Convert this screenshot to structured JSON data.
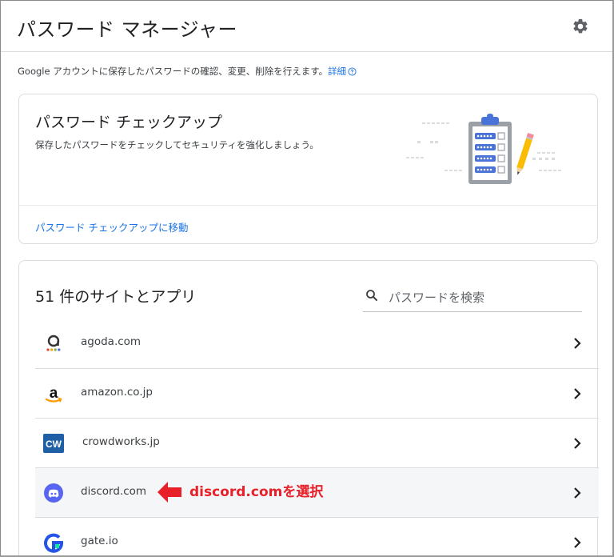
{
  "header": {
    "title": "パスワード マネージャー",
    "settings_icon": "gear-icon"
  },
  "description": {
    "text": "Google アカウントに保存したパスワードの確認、変更、削除を行えます。",
    "link": "詳細",
    "help_icon": "help-circle-icon"
  },
  "checkup": {
    "title": "パスワード チェックアップ",
    "subtitle": "保存したパスワードをチェックしてセキュリティを強化しましょう。",
    "link": "パスワード チェックアップに移動",
    "illustration": "clipboard-checklist-pencil-illustration"
  },
  "passwords": {
    "count_label": "51 件のサイトとアプリ",
    "search_placeholder": "パスワードを検索",
    "items": [
      {
        "site": "agoda.com",
        "icon": "agoda-icon"
      },
      {
        "site": "amazon.co.jp",
        "icon": "amazon-icon"
      },
      {
        "site": "crowdworks.jp",
        "icon": "crowdworks-icon"
      },
      {
        "site": "discord.com",
        "icon": "discord-icon"
      },
      {
        "site": "gate.io",
        "icon": "gate-io-icon"
      }
    ]
  },
  "annotation": {
    "text": "discord.comを選択",
    "color": "#e8202a"
  },
  "colors": {
    "link": "#1a73e8",
    "annotation_red": "#e8202a",
    "clipboard_blue": "#4a73d8"
  }
}
